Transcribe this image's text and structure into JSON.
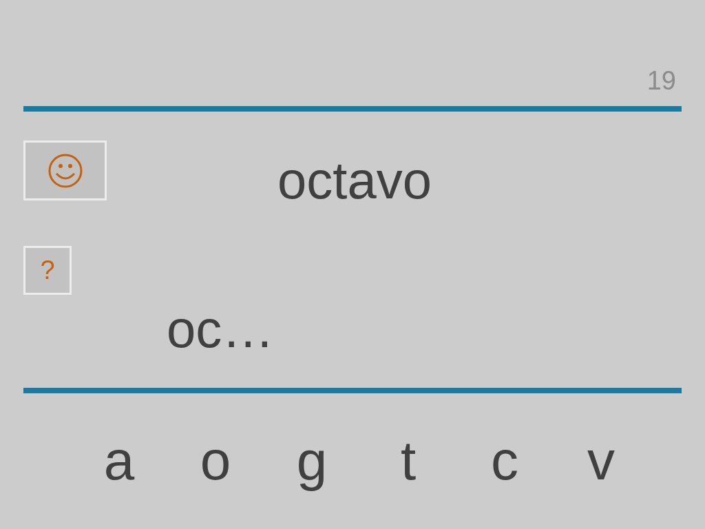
{
  "page_number": "19",
  "hint_button": {
    "label": "?"
  },
  "word": "octavo",
  "answer": "oc…",
  "letters": [
    "a",
    "o",
    "g",
    "t",
    "c",
    "v"
  ]
}
